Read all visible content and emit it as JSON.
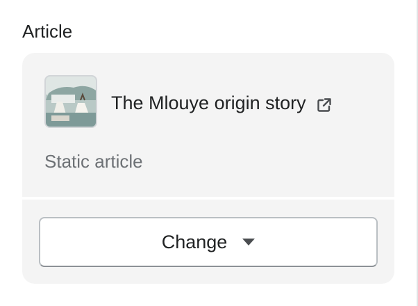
{
  "section": {
    "heading": "Article"
  },
  "article": {
    "title": "The Mlouye origin story",
    "subtitle": "Static article",
    "thumbnail_icon": "article-thumbnail-image",
    "external_link_icon": "external-link-icon"
  },
  "actions": {
    "change_label": "Change",
    "change_icon": "caret-down-icon"
  },
  "colors": {
    "card_background": "#f4f4f4",
    "text_primary": "#202223",
    "text_subdued": "#6d7175",
    "button_border": "#babfc3"
  }
}
